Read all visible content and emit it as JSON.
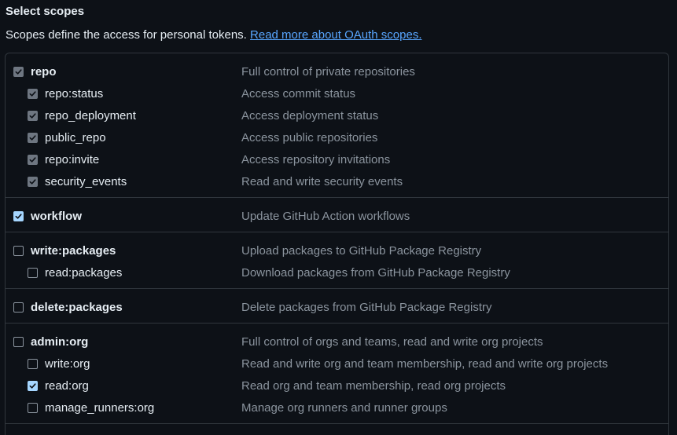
{
  "section": {
    "title": "Select scopes",
    "description": "Scopes define the access for personal tokens.",
    "link_text": "Read more about OAuth scopes."
  },
  "colors": {
    "background": "#0d1117",
    "border": "#30363d",
    "link": "#58a6ff",
    "checked": "#a5d6ff",
    "muted_text": "#8b949e"
  },
  "groups": [
    {
      "scopes": [
        {
          "name": "repo",
          "description": "Full control of private repositories",
          "level": "parent",
          "state": "checked-disabled"
        },
        {
          "name": "repo:status",
          "description": "Access commit status",
          "level": "child",
          "state": "checked-disabled"
        },
        {
          "name": "repo_deployment",
          "description": "Access deployment status",
          "level": "child",
          "state": "checked-disabled"
        },
        {
          "name": "public_repo",
          "description": "Access public repositories",
          "level": "child",
          "state": "checked-disabled"
        },
        {
          "name": "repo:invite",
          "description": "Access repository invitations",
          "level": "child",
          "state": "checked-disabled"
        },
        {
          "name": "security_events",
          "description": "Read and write security events",
          "level": "child",
          "state": "checked-disabled"
        }
      ]
    },
    {
      "scopes": [
        {
          "name": "workflow",
          "description": "Update GitHub Action workflows",
          "level": "parent",
          "state": "checked"
        }
      ]
    },
    {
      "scopes": [
        {
          "name": "write:packages",
          "description": "Upload packages to GitHub Package Registry",
          "level": "parent",
          "state": "unchecked"
        },
        {
          "name": "read:packages",
          "description": "Download packages from GitHub Package Registry",
          "level": "child",
          "state": "unchecked"
        }
      ]
    },
    {
      "scopes": [
        {
          "name": "delete:packages",
          "description": "Delete packages from GitHub Package Registry",
          "level": "parent",
          "state": "unchecked"
        }
      ]
    },
    {
      "scopes": [
        {
          "name": "admin:org",
          "description": "Full control of orgs and teams, read and write org projects",
          "level": "parent",
          "state": "unchecked"
        },
        {
          "name": "write:org",
          "description": "Read and write org and team membership, read and write org projects",
          "level": "child",
          "state": "unchecked"
        },
        {
          "name": "read:org",
          "description": "Read org and team membership, read org projects",
          "level": "child",
          "state": "checked"
        },
        {
          "name": "manage_runners:org",
          "description": "Manage org runners and runner groups",
          "level": "child",
          "state": "unchecked"
        }
      ]
    }
  ]
}
